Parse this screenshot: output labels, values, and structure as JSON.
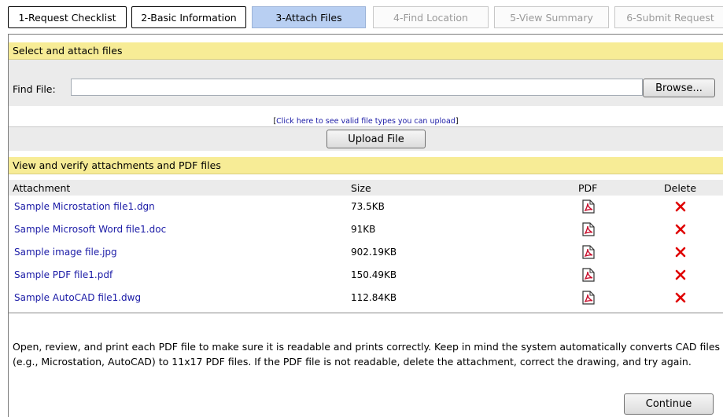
{
  "tabs": [
    {
      "label": "1-Request Checklist",
      "state": "done"
    },
    {
      "label": "2-Basic Information",
      "state": "done"
    },
    {
      "label": "3-Attach Files",
      "state": "active"
    },
    {
      "label": "4-Find Location",
      "state": "disabled"
    },
    {
      "label": "5-View Summary",
      "state": "disabled"
    },
    {
      "label": "6-Submit Request",
      "state": "disabled"
    }
  ],
  "select_section": {
    "title": "Select and attach files",
    "find_label": "Find File:",
    "find_value": "",
    "browse_label": "Browse...",
    "help_open": "[",
    "help_link": "Click here to see valid file types you can upload",
    "help_close": "]",
    "upload_label": "Upload File"
  },
  "verify_section": {
    "title": "View and verify attachments and PDF files",
    "columns": {
      "attachment": "Attachment",
      "size": "Size",
      "pdf": "PDF",
      "delete": "Delete"
    },
    "rows": [
      {
        "name": "Sample Microstation file1.dgn",
        "size": "73.5KB"
      },
      {
        "name": "Sample Microsoft Word file1.doc",
        "size": "91KB"
      },
      {
        "name": "Sample image file.jpg",
        "size": "902.19KB"
      },
      {
        "name": "Sample PDF file1.pdf",
        "size": "150.49KB"
      },
      {
        "name": "Sample AutoCAD file1.dwg",
        "size": "112.84KB"
      }
    ]
  },
  "note": "Open, review, and print each PDF file to make sure it is readable and prints correctly. Keep in mind the system automatically converts CAD files (e.g., Microstation, AutoCAD) to 11x17 PDF files. If the PDF file is not readable, delete the attachment, correct the drawing, and try again.",
  "continue_label": "Continue",
  "colors": {
    "section_header": "#f7ec96",
    "active_tab": "#b8cff2",
    "link": "#1a1aa6",
    "delete": "#e00000",
    "pdf": "#c8102e"
  }
}
